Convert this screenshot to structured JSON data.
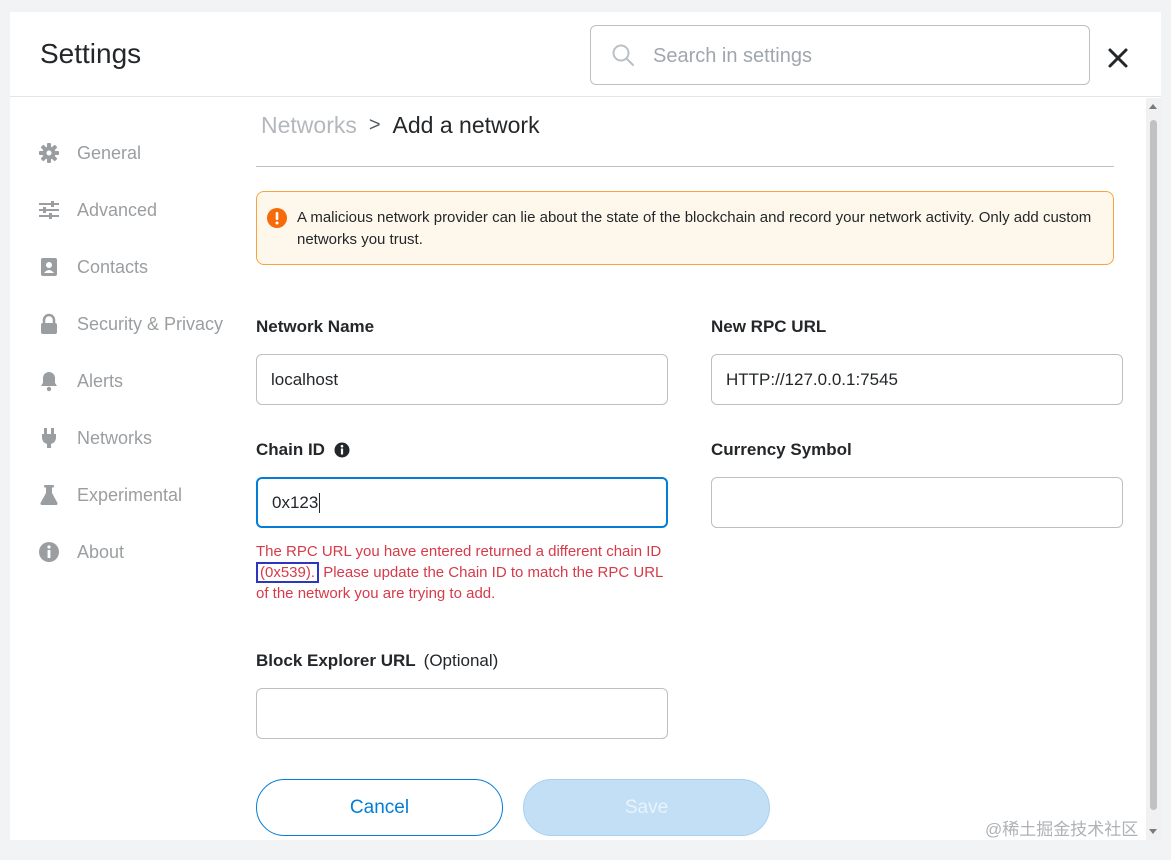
{
  "header": {
    "title": "Settings",
    "search_placeholder": "Search in settings"
  },
  "sidebar": {
    "items": [
      {
        "label": "General",
        "icon": "gear-icon"
      },
      {
        "label": "Advanced",
        "icon": "sliders-icon"
      },
      {
        "label": "Contacts",
        "icon": "address-book-icon"
      },
      {
        "label": "Security & Privacy",
        "icon": "lock-icon"
      },
      {
        "label": "Alerts",
        "icon": "bell-icon"
      },
      {
        "label": "Networks",
        "icon": "plug-icon"
      },
      {
        "label": "Experimental",
        "icon": "flask-icon"
      },
      {
        "label": "About",
        "icon": "info-icon"
      }
    ]
  },
  "breadcrumb": {
    "parent": "Networks",
    "separator": ">",
    "current": "Add a network"
  },
  "warning": {
    "text": "A malicious network provider can lie about the state of the blockchain and record your network activity. Only add custom networks you trust."
  },
  "form": {
    "network_name": {
      "label": "Network Name",
      "value": "localhost"
    },
    "rpc_url": {
      "label": "New RPC URL",
      "value": "HTTP://127.0.0.1:7545"
    },
    "chain_id": {
      "label": "Chain ID",
      "value": "0x123"
    },
    "currency_symbol": {
      "label": "Currency Symbol",
      "value": ""
    },
    "block_explorer": {
      "label": "Block Explorer URL",
      "optional": "(Optional)",
      "value": ""
    },
    "error": {
      "pre": "The RPC URL you have entered returned a different chain ID",
      "highlight": "(0x539).",
      "post": "Please update the Chain ID to match the RPC URL of the network you are trying to add."
    }
  },
  "buttons": {
    "cancel": "Cancel",
    "save": "Save"
  },
  "watermark": "@稀土掘金技术社区",
  "colors": {
    "accent": "#037dd6",
    "error": "#d73a49",
    "warning_border": "#f8a33e",
    "warning_bg": "#fef8ec",
    "save_disabled_bg": "#c2dff5"
  }
}
